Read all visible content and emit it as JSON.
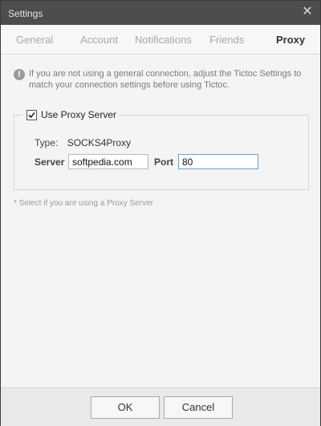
{
  "window": {
    "title": "Settings",
    "close_label": "✕"
  },
  "tabs": [
    {
      "label": "General",
      "active": false
    },
    {
      "label": "Account",
      "active": false
    },
    {
      "label": "Notifications",
      "active": false
    },
    {
      "label": "Friends",
      "active": false
    },
    {
      "label": "Proxy",
      "active": true
    }
  ],
  "info": {
    "icon": "!",
    "text": "If you are not using a general connection, adjust the Tictoc Settings to match your connection settings before using Tictoc."
  },
  "proxy": {
    "use_proxy_label": "Use Proxy Server",
    "use_proxy_checked": true,
    "type_label": "Type:",
    "type_value": "SOCKS4Proxy",
    "server_label": "Server",
    "server_value": "softpedia.com",
    "port_label": "Port",
    "port_value": "80"
  },
  "hint": "* Select if you are using a Proxy Server",
  "footer": {
    "ok_label": "OK",
    "cancel_label": "Cancel"
  },
  "colors": {
    "titlebar": "#4d4d4d",
    "active_tab": "#333333",
    "inactive_tab": "#a8a8a8",
    "focus_border": "#6c9fd1"
  }
}
